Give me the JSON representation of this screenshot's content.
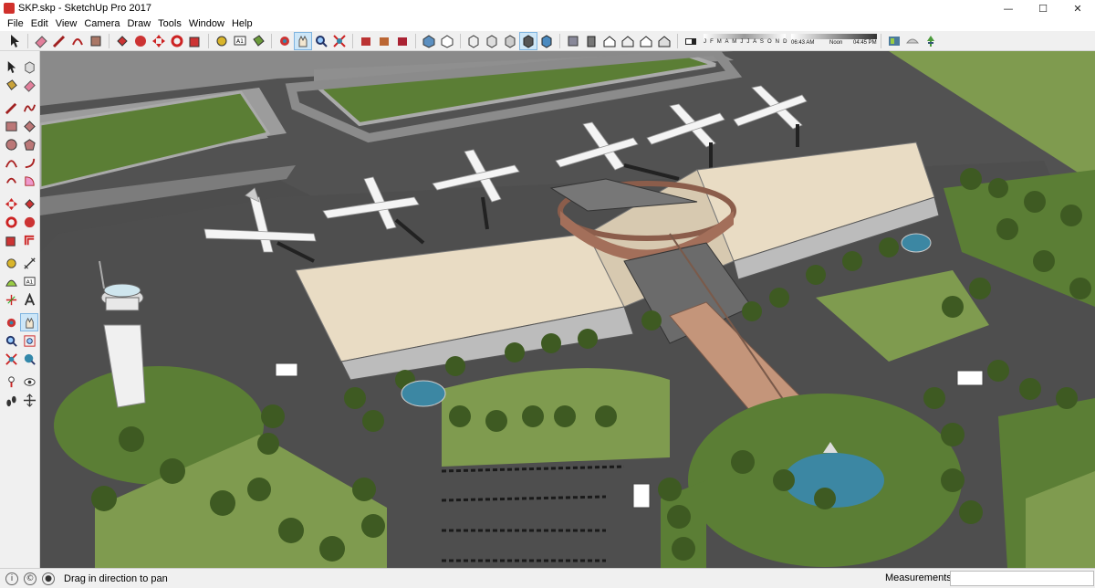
{
  "window": {
    "title": "SKP.skp - SketchUp Pro 2017",
    "controls": {
      "minimize": "—",
      "maximize": "☐",
      "close": "✕"
    }
  },
  "menu": [
    "File",
    "Edit",
    "View",
    "Camera",
    "Draw",
    "Tools",
    "Window",
    "Help"
  ],
  "toolbar": {
    "icons": [
      "select-icon",
      "eraser-icon",
      "line-icon",
      "shape-icon",
      "paint-icon",
      "push-pull-icon",
      "follow-me-icon",
      "move-icon",
      "rotate-icon",
      "scale-icon",
      "tape-measure-icon",
      "text-icon",
      "paint-bucket-icon",
      "orbit-icon",
      "pan-icon",
      "zoom-icon",
      "zoom-extents-icon",
      "3d-warehouse-icon",
      "extension-warehouse-icon",
      "layout-icon",
      "style-icon",
      "iso-view-icon",
      "top-view-icon",
      "front-view-icon",
      "right-view-icon",
      "back-view-icon",
      "left-view-icon",
      "xray-icon",
      "wireframe-icon",
      "hidden-line-icon",
      "shaded-icon",
      "textured-icon",
      "monochrome-icon",
      "camera-position-icon",
      "walk-icon",
      "look-around-icon",
      "section-plane-icon",
      "display-section-icon",
      "shadows-icon",
      "fog-icon",
      "geo-location-icon"
    ],
    "shadow": {
      "months": "J F M A M J J A S O N D",
      "time_start": "06:43 AM",
      "time_mid": "Noon",
      "time_end": "04:45 PM"
    }
  },
  "status": {
    "message": "Drag in direction to pan",
    "measurements_label": "Measurements",
    "measurements_value": ""
  },
  "colors": {
    "grass": "#5b7e35",
    "light_grass": "#7f9b4f",
    "asphalt": "#4d4d4d",
    "road": "#9a9a9a",
    "roof": "#e9dcc4",
    "water": "#3c87a3"
  }
}
